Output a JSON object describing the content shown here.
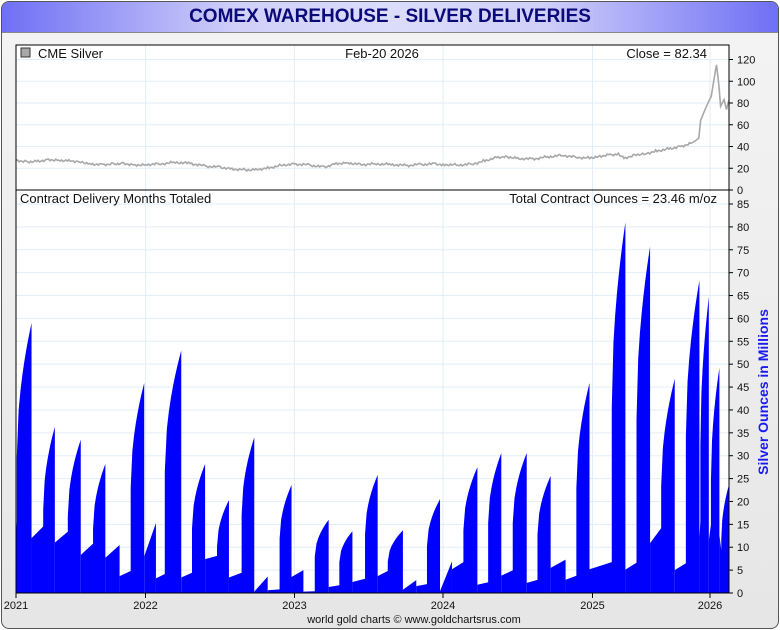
{
  "title": "COMEX WAREHOUSE - SILVER DELIVERIES",
  "footer": "world gold charts © www.goldchartsrus.com",
  "colors": {
    "deliveries": "#0000ff",
    "price": "#a8a8a8",
    "grid": "#e3eef8",
    "title_text": "#0a0a78",
    "axis_title": "#1a1aee"
  },
  "chart_data": [
    {
      "type": "line",
      "panel": "top",
      "legend": "CME Silver",
      "legend_icon": "gray-square-icon",
      "date_label": "Feb-20  2026",
      "close_label": "Close = 82.34",
      "ylim": [
        0,
        120
      ],
      "yticks": [
        0,
        20,
        40,
        60,
        80,
        100,
        120
      ],
      "series": [
        {
          "name": "CME Silver",
          "points": [
            [
              2021.0,
              27.5
            ],
            [
              2021.08,
              26
            ],
            [
              2021.17,
              26.5
            ],
            [
              2021.25,
              28
            ],
            [
              2021.33,
              27.5
            ],
            [
              2021.42,
              27
            ],
            [
              2021.5,
              26
            ],
            [
              2021.58,
              24
            ],
            [
              2021.67,
              23.5
            ],
            [
              2021.75,
              24
            ],
            [
              2021.83,
              24.5
            ],
            [
              2021.92,
              23
            ],
            [
              2022.0,
              23.5
            ],
            [
              2022.1,
              24
            ],
            [
              2022.2,
              25.5
            ],
            [
              2022.3,
              24.5
            ],
            [
              2022.4,
              22
            ],
            [
              2022.5,
              21
            ],
            [
              2022.58,
              19.5
            ],
            [
              2022.67,
              18.5
            ],
            [
              2022.75,
              19
            ],
            [
              2022.83,
              20.5
            ],
            [
              2022.92,
              23
            ],
            [
              2023.0,
              24
            ],
            [
              2023.1,
              23
            ],
            [
              2023.2,
              21
            ],
            [
              2023.28,
              24.5
            ],
            [
              2023.36,
              25
            ],
            [
              2023.45,
              23.5
            ],
            [
              2023.55,
              24
            ],
            [
              2023.65,
              23.5
            ],
            [
              2023.75,
              22.5
            ],
            [
              2023.85,
              23.5
            ],
            [
              2023.95,
              24
            ],
            [
              2024.0,
              23.5
            ],
            [
              2024.1,
              23
            ],
            [
              2024.2,
              24
            ],
            [
              2024.28,
              27
            ],
            [
              2024.36,
              30
            ],
            [
              2024.42,
              31
            ],
            [
              2024.5,
              29
            ],
            [
              2024.6,
              28.5
            ],
            [
              2024.7,
              30.5
            ],
            [
              2024.8,
              32
            ],
            [
              2024.9,
              30
            ],
            [
              2024.98,
              29.5
            ],
            [
              2025.05,
              31
            ],
            [
              2025.15,
              32.5
            ],
            [
              2025.22,
              33
            ],
            [
              2025.28,
              29.5
            ],
            [
              2025.36,
              32.5
            ],
            [
              2025.45,
              33.5
            ],
            [
              2025.55,
              36
            ],
            [
              2025.65,
              38
            ],
            [
              2025.75,
              40
            ],
            [
              2025.85,
              43.5
            ],
            [
              2025.905,
              47.5
            ],
            [
              2025.92,
              64
            ],
            [
              2025.97,
              77
            ],
            [
              2026.01,
              86
            ],
            [
              2026.055,
              115
            ],
            [
              2026.077,
              95
            ],
            [
              2026.09,
              77
            ],
            [
              2026.12,
              83
            ],
            [
              2026.14,
              74
            ],
            [
              2026.16,
              82.34
            ]
          ]
        }
      ]
    },
    {
      "type": "area",
      "panel": "bottom",
      "title_left": "Contract Delivery Months Totaled",
      "title_right": "Total Contract Ounces = 23.46 m/oz",
      "ylabel": "Silver Ounces in Millions",
      "ylim": [
        0,
        85
      ],
      "yticks": [
        0,
        5,
        10,
        15,
        20,
        25,
        30,
        35,
        40,
        45,
        50,
        55,
        60,
        65,
        70,
        75,
        80,
        85
      ],
      "xticks": [
        "2021",
        "2022",
        "2023",
        "2024",
        "2025",
        "2026"
      ],
      "xtick_values": [
        2021,
        2022,
        2023,
        2024,
        2025,
        2026
      ],
      "cycles_fields": [
        "start_year",
        "end_year",
        "low",
        "peak",
        "shape",
        "jump_fraction"
      ],
      "cycles": [
        [
          2021.0,
          2021.12,
          12,
          59,
          "spike",
          0.05
        ],
        [
          2021.12,
          2021.3,
          12,
          36.3,
          "spike",
          0.5
        ],
        [
          2021.3,
          2021.5,
          11,
          33.5,
          "spike",
          0.5
        ],
        [
          2021.5,
          2021.69,
          8.3,
          28.2,
          "spike",
          0.5
        ],
        [
          2021.69,
          2021.8,
          7.7,
          10.5,
          "linear",
          0
        ],
        [
          2021.8,
          2021.99,
          3.7,
          45.9,
          "spike",
          0.45
        ],
        [
          2021.99,
          2022.07,
          8,
          15.3,
          "linear",
          0
        ],
        [
          2022.07,
          2022.24,
          3.2,
          53,
          "spike",
          0.35
        ],
        [
          2022.24,
          2022.4,
          3.4,
          28.2,
          "spike",
          0.45
        ],
        [
          2022.4,
          2022.56,
          7.4,
          20.3,
          "spike",
          0.5
        ],
        [
          2022.56,
          2022.73,
          3.4,
          34,
          "spike",
          0.5
        ],
        [
          2022.73,
          2022.82,
          0.3,
          3.6,
          "linear",
          0
        ],
        [
          2022.82,
          2022.98,
          0.6,
          23.6,
          "spike",
          0.5
        ],
        [
          2022.98,
          2023.06,
          3.5,
          5,
          "linear",
          0
        ],
        [
          2023.06,
          2023.23,
          0.3,
          16,
          "spike",
          0.45
        ],
        [
          2023.23,
          2023.39,
          1.3,
          13.5,
          "spike",
          0.45
        ],
        [
          2023.39,
          2023.56,
          2.4,
          25.8,
          "spike",
          0.5
        ],
        [
          2023.56,
          2023.73,
          3.7,
          13.7,
          "spike",
          0.4
        ],
        [
          2023.73,
          2023.82,
          0.7,
          2.8,
          "linear",
          0
        ],
        [
          2023.82,
          2023.98,
          1.5,
          20.5,
          "spike",
          0.45
        ],
        [
          2023.98,
          2024.06,
          0.4,
          6.9,
          "linear",
          0
        ],
        [
          2024.06,
          2024.23,
          5.2,
          27.5,
          "spike",
          0.45
        ],
        [
          2024.23,
          2024.39,
          1.8,
          30.6,
          "spike",
          0.45
        ],
        [
          2024.39,
          2024.56,
          3.8,
          30.6,
          "spike",
          0.45
        ],
        [
          2024.56,
          2024.72,
          2.2,
          25.6,
          "spike",
          0.45
        ],
        [
          2024.72,
          2024.82,
          5.5,
          7.3,
          "linear",
          0
        ],
        [
          2024.82,
          2024.98,
          2.9,
          45.9,
          "spike",
          0.45
        ],
        [
          2024.98,
          2025.28,
          5.2,
          81,
          "spike",
          0.62
        ],
        [
          2025.28,
          2025.49,
          5.1,
          75.7,
          "spike",
          0.45
        ],
        [
          2025.49,
          2025.7,
          10.9,
          46.8,
          "spike",
          0.45
        ],
        [
          2025.7,
          2025.91,
          5,
          68.3,
          "spike",
          0.45
        ],
        [
          2025.91,
          2025.99,
          12,
          64.7,
          "spike",
          0.1
        ],
        [
          2025.99,
          2026.08,
          11.5,
          49.2,
          "spike",
          0.2
        ],
        [
          2026.08,
          2026.16,
          12.7,
          23.5,
          "spike",
          0.2
        ]
      ]
    }
  ]
}
